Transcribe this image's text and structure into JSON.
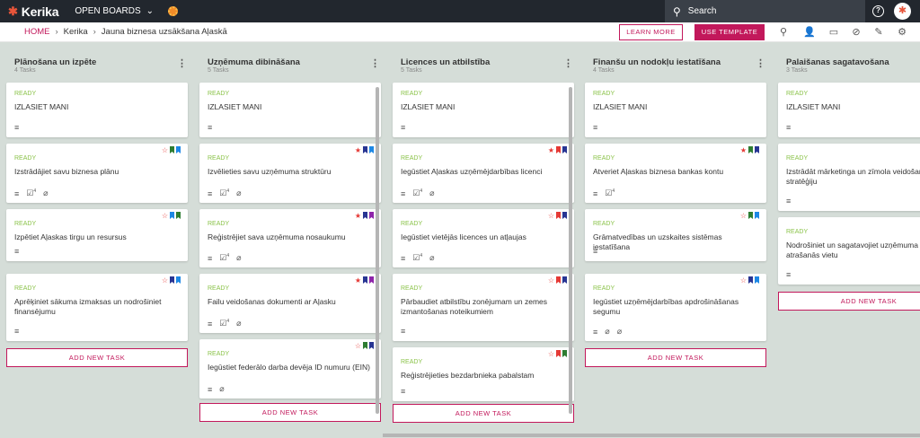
{
  "topbar": {
    "logo": "Kerika",
    "open_boards": "OPEN BOARDS",
    "search_placeholder": "Search"
  },
  "breadcrumb": {
    "home": "HOME",
    "org": "Kerika",
    "board": "Jauna biznesa uzsākšana Aļaskā"
  },
  "actions": {
    "learn_more": "LEARN MORE",
    "use_template": "USE TEMPLATE"
  },
  "colors": {
    "accent": "#c2185b",
    "ready": "#8bc34a",
    "red": "#e53935",
    "green": "#2e7d32",
    "blue": "#1e88e5",
    "navy": "#283593",
    "purple": "#8e24aa"
  },
  "columns": [
    {
      "title": "Plānošana un izpēte",
      "count": "4 Tasks",
      "add_label": "ADD NEW TASK",
      "cards": [
        {
          "status": "READY",
          "title": "IZLASIET MANI"
        },
        {
          "status": "READY",
          "title": "Izstrādājiet savu biznesa plānu",
          "checklist": "4"
        },
        {
          "status": "READY",
          "title": "Izpētiet Aļaskas tirgu un resursus"
        },
        {
          "status": "READY",
          "title": "Aprēķiniet sākuma izmaksas un nodrošiniet finansējumu"
        }
      ]
    },
    {
      "title": "Uzņēmuma dibināšana",
      "count": "5 Tasks",
      "add_label": "ADD NEW TASK",
      "cards": [
        {
          "status": "READY",
          "title": "IZLASIET MANI"
        },
        {
          "status": "READY",
          "title": "Izvēlieties savu uzņēmuma struktūru",
          "checklist": "4"
        },
        {
          "status": "READY",
          "title": "Reģistrējiet sava uzņēmuma nosaukumu",
          "checklist": "4"
        },
        {
          "status": "READY",
          "title": "Failu veidošanas dokumenti ar Aļasku",
          "checklist": "4"
        },
        {
          "status": "READY",
          "title": "Iegūstiet federālo darba devēja ID numuru (EIN)"
        }
      ]
    },
    {
      "title": "Licences un atbilstība",
      "count": "5 Tasks",
      "add_label": "ADD NEW TASK",
      "cards": [
        {
          "status": "READY",
          "title": "IZLASIET MANI"
        },
        {
          "status": "READY",
          "title": "Iegūstiet Aļaskas uzņēmējdarbības licenci",
          "checklist": "4"
        },
        {
          "status": "READY",
          "title": "Iegūstiet vietējās licences un atļaujas",
          "checklist": "4"
        },
        {
          "status": "READY",
          "title": "Pārbaudiet atbilstību zonējumam un zemes izmantošanas noteikumiem"
        },
        {
          "status": "READY",
          "title": "Reģistrējieties bezdarbnieka pabalstam"
        }
      ]
    },
    {
      "title": "Finanšu un nodokļu iestatīšana",
      "count": "4 Tasks",
      "add_label": "ADD NEW TASK",
      "cards": [
        {
          "status": "READY",
          "title": "IZLASIET MANI"
        },
        {
          "status": "READY",
          "title": "Atveriet Aļaskas biznesa bankas kontu",
          "checklist": "4"
        },
        {
          "status": "READY",
          "title": "Grāmatvedības un uzskaites sistēmas iestatīšana"
        },
        {
          "status": "READY",
          "title": "Iegūstiet uzņēmējdarbības apdrošināšanas segumu"
        }
      ]
    },
    {
      "title": "Palaišanas sagatavošana",
      "count": "3 Tasks",
      "add_label": "ADD NEW TASK",
      "cards": [
        {
          "status": "READY",
          "title": "IZLASIET MANI"
        },
        {
          "status": "READY",
          "title": "Izstrādāt mārketinga un zīmola veidošanas stratēģiju"
        },
        {
          "status": "READY",
          "title": "Nodrošiniet un sagatavojiet uzņēmuma atrašanās vietu"
        }
      ]
    }
  ]
}
